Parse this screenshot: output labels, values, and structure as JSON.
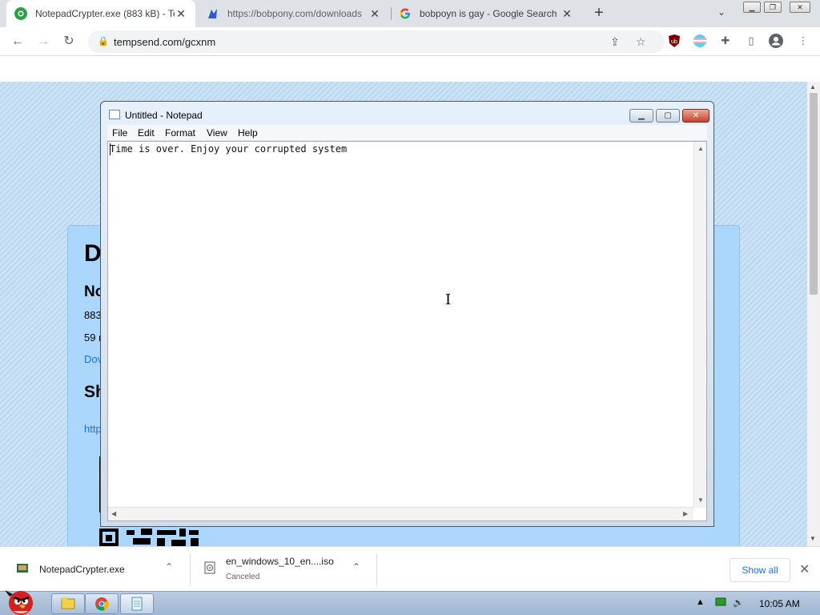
{
  "browser": {
    "tabs": [
      {
        "title": "NotepadCrypter.exe (883 kB) - Te",
        "active": true
      },
      {
        "title": "https://bobpony.com/downloads",
        "active": false
      },
      {
        "title": "bobpoyn is gay - Google Search",
        "active": false
      }
    ],
    "new_tab": "+",
    "tab_search": "⌄",
    "address": "tempsend.com/gcxnm"
  },
  "page": {
    "heading": "D",
    "subheading": "No",
    "size_text": "883",
    "time_text": "59 r",
    "download_link": "Dov",
    "share_heading": "Sh",
    "share_link": "http"
  },
  "notepad": {
    "title": "Untitled - Notepad",
    "menu": [
      "File",
      "Edit",
      "Format",
      "View",
      "Help"
    ],
    "content": "Time is over. Enjoy your corrupted system"
  },
  "downloads": {
    "items": [
      {
        "name": "NotepadCrypter.exe",
        "status": ""
      },
      {
        "name": "en_windows_10_en....iso",
        "status": "Canceled"
      }
    ],
    "show_all": "Show all"
  },
  "taskbar": {
    "clock": "10:05 AM"
  },
  "colors": {
    "card_bg": "#aad7fb",
    "link": "#1a73e8"
  }
}
